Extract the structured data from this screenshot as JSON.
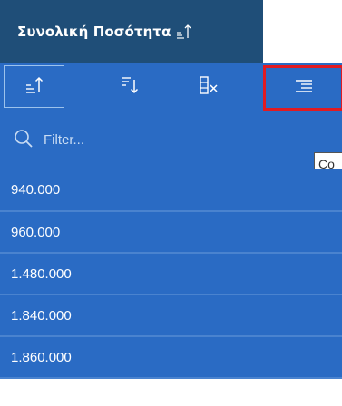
{
  "header": {
    "title": "Συνολική Ποσότητα"
  },
  "toolbar": {
    "sort_ascending": "sort-ascending-icon",
    "sort_descending": "sort-descending-icon",
    "clear_filter": "clear-filter-icon",
    "align": "align-right-icon"
  },
  "filter": {
    "placeholder": "Filter..."
  },
  "tooltip": {
    "text": "Co"
  },
  "rows": [
    "940.000",
    "960.000",
    "1.480.000",
    "1.840.000",
    "1.860.000"
  ],
  "colors": {
    "header_bg": "#1f4e78",
    "panel_bg": "#2a6bc4",
    "highlight_border": "#e11b22"
  }
}
